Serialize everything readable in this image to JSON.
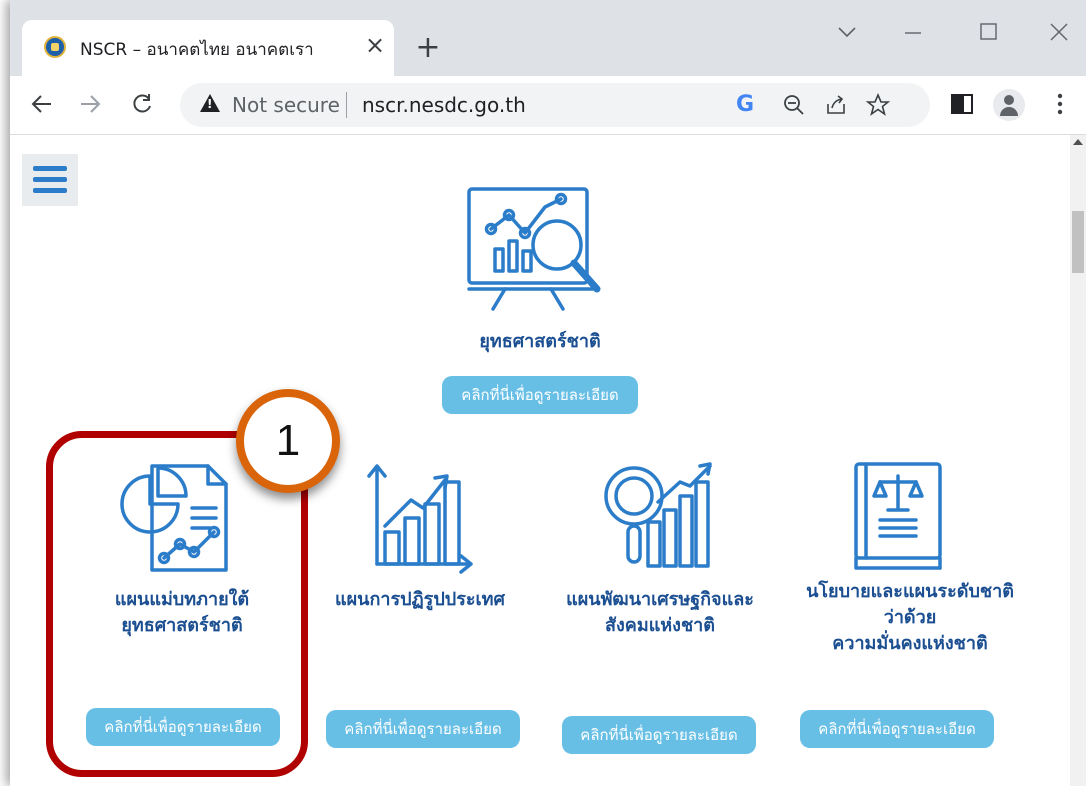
{
  "browser": {
    "tab_title": "NSCR – อนาคตไทย อนาคตเรา",
    "tab_close": "×",
    "new_tab": "+",
    "not_secure": "Not secure",
    "url": "nscr.nesdc.go.th",
    "google_glyph": "G"
  },
  "page": {
    "top_card": {
      "title": "ยุทธศาสตร์ชาติ",
      "button": "คลิกที่นี่เพื่อดูรายละเอียด"
    },
    "cards": [
      {
        "title_line1": "แผนแม่บทภายใต้",
        "title_line2": "ยุทธศาสตร์ชาติ",
        "button": "คลิกที่นี่เพื่อดูรายละเอียด"
      },
      {
        "title_line1": "แผนการปฏิรูปประเทศ",
        "button": "คลิกที่นี่เพื่อดูรายละเอียด"
      },
      {
        "title_line1": "แผนพัฒนาเศรษฐกิจและ",
        "title_line2": "สังคมแห่งชาติ",
        "button": "คลิกที่นี่เพื่อดูรายละเอียด"
      },
      {
        "title_line1": "นโยบายและแผนระดับชาติ",
        "title_line2": "ว่าด้วย",
        "title_line3": "ความมั่นคงแห่งชาติ",
        "button": "คลิกที่นี่เพื่อดูรายละเอียด"
      }
    ]
  },
  "annotation": {
    "step_number": "1"
  },
  "colors": {
    "icon_blue": "#2c7dc9",
    "title_blue": "#1b4f91",
    "button_blue": "#68bfe6",
    "highlight_red": "#b00000",
    "badge_orange": "#d9640a"
  }
}
